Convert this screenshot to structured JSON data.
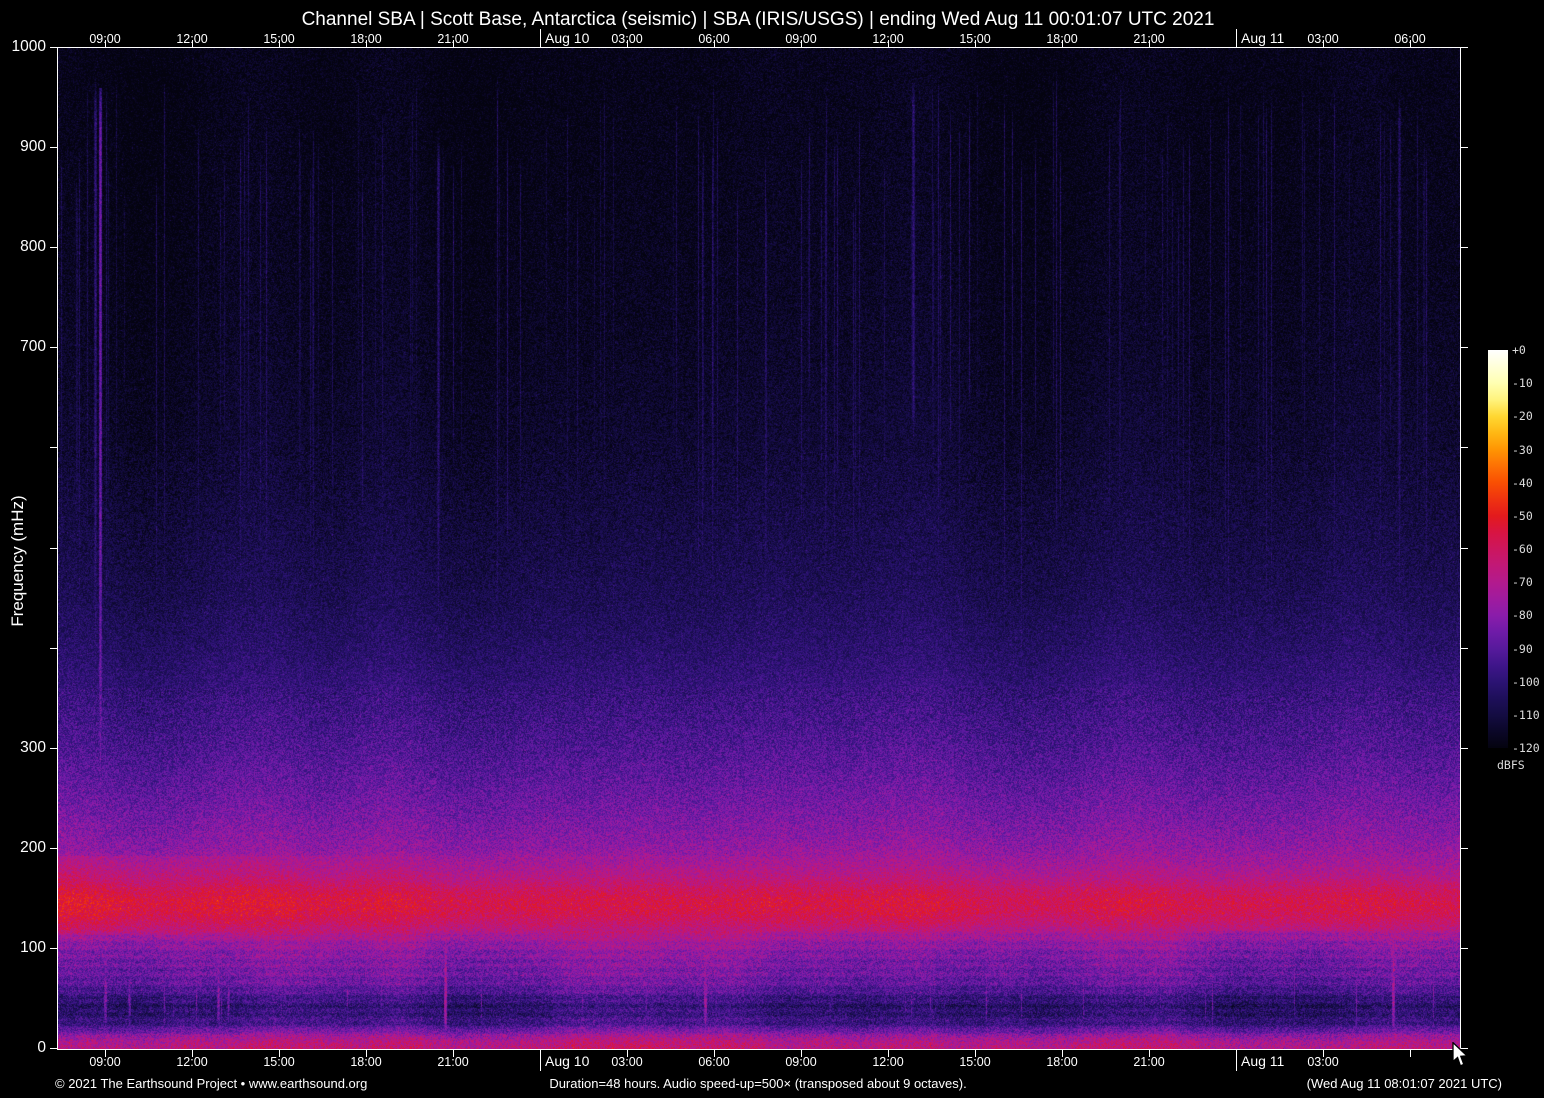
{
  "footer": {
    "left": "© 2021 The Earthsound Project • www.earthsound.org",
    "center": "Duration=48 hours. Audio speed-up=500× (transposed about 9 octaves).",
    "right": "(Wed Aug 11 08:01:07 2021 UTC)"
  },
  "chart_data": {
    "type": "heatmap",
    "subtype": "audio-spectrogram",
    "title": "Channel SBA | Scott Base, Antarctica (seismic) | SBA (IRIS/USGS) | ending Wed Aug 11 00:01:07 UTC 2021",
    "ylabel": "Frequency (mHz)",
    "y_range_mhz": [
      0,
      1000
    ],
    "duration_hours": 48,
    "grid": false,
    "x_ticks": [
      {
        "label": "09:00",
        "x": 0.0342,
        "date": false,
        "bottom": true
      },
      {
        "label": "12:00",
        "x": 0.0963,
        "date": false,
        "bottom": true
      },
      {
        "label": "15:00",
        "x": 0.1584,
        "date": false,
        "bottom": true
      },
      {
        "label": "18:00",
        "x": 0.2204,
        "date": false,
        "bottom": true
      },
      {
        "label": "21:00",
        "x": 0.2825,
        "date": false,
        "bottom": true
      },
      {
        "label": "Aug 10",
        "x": 0.3445,
        "date": true,
        "bottom": true
      },
      {
        "label": "03:00",
        "x": 0.4066,
        "date": false,
        "bottom": true
      },
      {
        "label": "06:00",
        "x": 0.4686,
        "date": false,
        "bottom": true
      },
      {
        "label": "09:00",
        "x": 0.5307,
        "date": false,
        "bottom": true
      },
      {
        "label": "12:00",
        "x": 0.5927,
        "date": false,
        "bottom": true
      },
      {
        "label": "15:00",
        "x": 0.6548,
        "date": false,
        "bottom": true
      },
      {
        "label": "18:00",
        "x": 0.7168,
        "date": false,
        "bottom": true
      },
      {
        "label": "21:00",
        "x": 0.7789,
        "date": false,
        "bottom": true
      },
      {
        "label": "Aug 11",
        "x": 0.8409,
        "date": true,
        "bottom": true
      },
      {
        "label": "03:00",
        "x": 0.903,
        "date": false,
        "bottom": true
      },
      {
        "label": "06:00",
        "x": 0.9651,
        "date": false,
        "bottom": false
      }
    ],
    "y_ticks": [
      {
        "v": 1000,
        "label": "1000"
      },
      {
        "v": 900,
        "label": "900"
      },
      {
        "v": 800,
        "label": "800"
      },
      {
        "v": 700,
        "label": "700"
      },
      {
        "v": 600,
        "label": ""
      },
      {
        "v": 500,
        "label": ""
      },
      {
        "v": 400,
        "label": ""
      },
      {
        "v": 300,
        "label": "300"
      },
      {
        "v": 200,
        "label": "200"
      },
      {
        "v": 100,
        "label": "100"
      },
      {
        "v": 0,
        "label": "0"
      }
    ],
    "colorbar": {
      "unit": "dBFS",
      "tick_labels": [
        "+0",
        "-10",
        "-20",
        "-30",
        "-40",
        "-50",
        "-60",
        "-70",
        "-80",
        "-90",
        "-100",
        "-110",
        "-120"
      ],
      "range_db": [
        0,
        -120
      ]
    },
    "colormap_stops": [
      [
        -120,
        "#04030f"
      ],
      [
        -115,
        "#0b0728"
      ],
      [
        -110,
        "#140c42"
      ],
      [
        -105,
        "#1e0f5a"
      ],
      [
        -100,
        "#2c1374"
      ],
      [
        -95,
        "#3f158a"
      ],
      [
        -90,
        "#571a9c"
      ],
      [
        -85,
        "#6f1ba8"
      ],
      [
        -80,
        "#8a1caa"
      ],
      [
        -75,
        "#a01b9e"
      ],
      [
        -70,
        "#b31a8d"
      ],
      [
        -65,
        "#c11877"
      ],
      [
        -60,
        "#cc165e"
      ],
      [
        -55,
        "#d81442"
      ],
      [
        -50,
        "#e31a1d"
      ],
      [
        -45,
        "#ef3310"
      ],
      [
        -40,
        "#f94f02"
      ],
      [
        -35,
        "#fd7004"
      ],
      [
        -30,
        "#ff9503"
      ],
      [
        -25,
        "#ffb814"
      ],
      [
        -20,
        "#ffd732"
      ],
      [
        -15,
        "#fff37d"
      ],
      [
        -10,
        "#ffffb2"
      ],
      [
        -5,
        "#ffffd8"
      ],
      [
        0,
        "#ffffff"
      ]
    ],
    "base_profile_mhz_dbfs": [
      [
        0,
        -66
      ],
      [
        3,
        -67
      ],
      [
        8,
        -70
      ],
      [
        14,
        -77
      ],
      [
        20,
        -90
      ],
      [
        26,
        -96
      ],
      [
        34,
        -99
      ],
      [
        42,
        -101
      ],
      [
        50,
        -97
      ],
      [
        60,
        -90
      ],
      [
        70,
        -86
      ],
      [
        80,
        -84
      ],
      [
        90,
        -82
      ],
      [
        100,
        -79
      ],
      [
        110,
        -74
      ],
      [
        118,
        -68
      ],
      [
        128,
        -62
      ],
      [
        138,
        -58
      ],
      [
        148,
        -57.5
      ],
      [
        158,
        -61
      ],
      [
        170,
        -68
      ],
      [
        185,
        -74
      ],
      [
        200,
        -78
      ],
      [
        230,
        -83
      ],
      [
        260,
        -87
      ],
      [
        300,
        -92
      ],
      [
        350,
        -97
      ],
      [
        400,
        -102
      ],
      [
        450,
        -106
      ],
      [
        500,
        -108.5
      ],
      [
        600,
        -113
      ],
      [
        700,
        -115.5
      ],
      [
        800,
        -117
      ],
      [
        900,
        -118
      ],
      [
        1000,
        -118.5
      ]
    ],
    "band_left_boost_db": 6,
    "events": [
      {
        "x": 0.0265,
        "w": 1,
        "f": [
          20,
          970
        ],
        "level": -100
      },
      {
        "x": 0.03,
        "w": 1,
        "f": [
          60,
          960
        ],
        "level": -86
      },
      {
        "x": 0.0335,
        "w": 1,
        "f": [
          15,
          130
        ],
        "level": -80
      },
      {
        "x": 0.051,
        "w": 1,
        "f": [
          15,
          120
        ],
        "level": -84
      },
      {
        "x": 0.114,
        "w": 1,
        "f": [
          15,
          125
        ],
        "level": -80
      },
      {
        "x": 0.121,
        "w": 1,
        "f": [
          15,
          120
        ],
        "level": -85
      },
      {
        "x": 0.271,
        "w": 1,
        "f": [
          120,
          920
        ],
        "level": -102
      },
      {
        "x": 0.276,
        "w": 1,
        "f": [
          8,
          135
        ],
        "level": -72
      },
      {
        "x": 0.33,
        "w": 0,
        "f": [
          380,
          900
        ],
        "level": -107
      },
      {
        "x": 0.457,
        "w": 0,
        "f": [
          430,
          950
        ],
        "level": -105
      },
      {
        "x": 0.462,
        "w": 1,
        "f": [
          8,
          130
        ],
        "level": -75
      },
      {
        "x": 0.61,
        "w": 1,
        "f": [
          600,
          975
        ],
        "level": -100
      },
      {
        "x": 0.75,
        "w": 0,
        "f": [
          480,
          940
        ],
        "level": -107
      },
      {
        "x": 0.862,
        "w": 0,
        "f": [
          290,
          950
        ],
        "level": -104
      },
      {
        "x": 0.953,
        "w": 1,
        "f": [
          8,
          145
        ],
        "level": -73
      },
      {
        "x": 0.957,
        "w": 1,
        "f": [
          300,
          960
        ],
        "level": -103
      }
    ],
    "random_streaks": {
      "upper_count": 120,
      "band_count": 26
    },
    "noise": {
      "seed": 20210811,
      "speckle_hi_prob": 0.018,
      "speckle_lo_prob": 0.006
    }
  }
}
